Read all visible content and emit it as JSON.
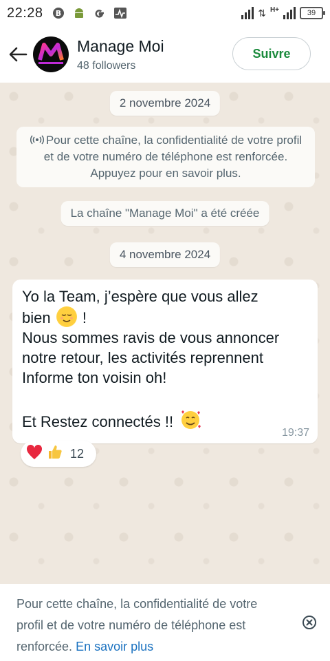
{
  "status_bar": {
    "time": "22:28",
    "left_icons": [
      "b-circle-icon",
      "android-icon",
      "google-icon",
      "activity-icon"
    ],
    "network_label": "H+",
    "battery": "39"
  },
  "header": {
    "title": "Manage Moi",
    "subtitle": "48 followers",
    "follow_label": "Suivre"
  },
  "chat": {
    "date1": "2 novembre 2024",
    "privacy_notice": "Pour cette chaîne, la confidentialité de votre profil et de votre numéro de téléphone est renforcée. Appuyez pour en savoir plus.",
    "created": "La chaîne \"Manage Moi\" a été créée",
    "date2": "4 novembre 2024",
    "message": {
      "line1": "Yo la Team, j’espère que vous allez",
      "line2": "bien",
      "line2_suffix": " !",
      "line3": "Nous sommes ravis de vous annoncer notre retour, les activités reprennent",
      "line4": "Informe ton voisin oh!",
      "line5": "Et Restez connectés !!",
      "time": "19:37"
    },
    "reactions": {
      "emojis": [
        "❤️",
        "👍"
      ],
      "count": "12"
    }
  },
  "banner": {
    "text": "Pour cette chaîne, la confidentialité de votre profil et de votre numéro de téléphone est renforcée.",
    "link": "En savoir plus"
  },
  "colors": {
    "accent_green": "#1a8a3c",
    "link_blue": "#1b72c0",
    "chat_bg": "#efe8df"
  }
}
